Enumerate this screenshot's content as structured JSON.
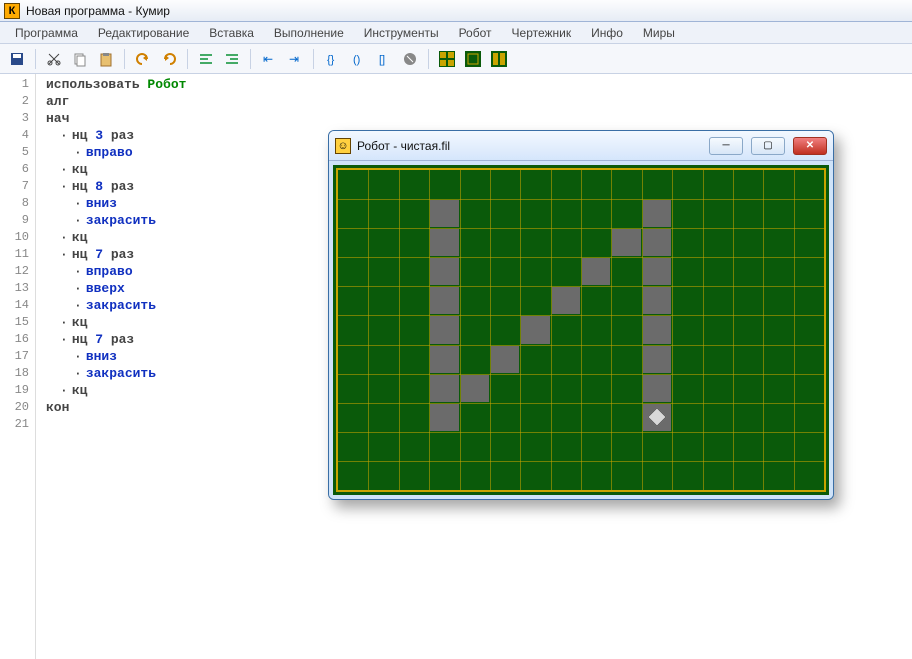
{
  "app_icon_letter": "К",
  "title": "Новая программа - Кумир",
  "menus": [
    "Программа",
    "Редактирование",
    "Вставка",
    "Выполнение",
    "Инструменты",
    "Робот",
    "Чертежник",
    "Инфо",
    "Миры"
  ],
  "toolbar_icons": [
    "save",
    "cut",
    "copy",
    "paste",
    "undo",
    "redo",
    "indent-left",
    "indent-right",
    "insert-left",
    "insert-right",
    "brace1",
    "brace2",
    "brace3",
    "stop",
    "grid-a",
    "grid-b",
    "grid-c"
  ],
  "code": [
    {
      "indent": 0,
      "tokens": [
        {
          "t": "использовать ",
          "c": "kw-gray"
        },
        {
          "t": "Робот",
          "c": "kw-use"
        }
      ]
    },
    {
      "indent": 0,
      "tokens": [
        {
          "t": "алг",
          "c": "kw-gray"
        }
      ]
    },
    {
      "indent": 0,
      "tokens": [
        {
          "t": "нач",
          "c": "kw-gray"
        }
      ]
    },
    {
      "indent": 1,
      "bullet": true,
      "tokens": [
        {
          "t": "нц ",
          "c": "kw-gray"
        },
        {
          "t": "3",
          "c": "kw-num"
        },
        {
          "t": " раз",
          "c": "kw-gray"
        }
      ]
    },
    {
      "indent": 2,
      "bullet": true,
      "tokens": [
        {
          "t": "вправо",
          "c": "kw-blue"
        }
      ]
    },
    {
      "indent": 1,
      "bullet": true,
      "tokens": [
        {
          "t": "кц",
          "c": "kw-gray"
        }
      ]
    },
    {
      "indent": 1,
      "bullet": true,
      "tokens": [
        {
          "t": "нц ",
          "c": "kw-gray"
        },
        {
          "t": "8",
          "c": "kw-num"
        },
        {
          "t": " раз",
          "c": "kw-gray"
        }
      ]
    },
    {
      "indent": 2,
      "bullet": true,
      "tokens": [
        {
          "t": "вниз",
          "c": "kw-blue"
        }
      ]
    },
    {
      "indent": 2,
      "bullet": true,
      "tokens": [
        {
          "t": "закрасить",
          "c": "kw-blue"
        }
      ]
    },
    {
      "indent": 1,
      "bullet": true,
      "tokens": [
        {
          "t": "кц",
          "c": "kw-gray"
        }
      ]
    },
    {
      "indent": 1,
      "bullet": true,
      "tokens": [
        {
          "t": "нц ",
          "c": "kw-gray"
        },
        {
          "t": "7",
          "c": "kw-num"
        },
        {
          "t": " раз",
          "c": "kw-gray"
        }
      ]
    },
    {
      "indent": 2,
      "bullet": true,
      "tokens": [
        {
          "t": "вправо",
          "c": "kw-blue"
        }
      ]
    },
    {
      "indent": 2,
      "bullet": true,
      "tokens": [
        {
          "t": "вверх",
          "c": "kw-blue"
        }
      ]
    },
    {
      "indent": 2,
      "bullet": true,
      "tokens": [
        {
          "t": "закрасить",
          "c": "kw-blue"
        }
      ]
    },
    {
      "indent": 1,
      "bullet": true,
      "tokens": [
        {
          "t": "кц",
          "c": "kw-gray"
        }
      ]
    },
    {
      "indent": 1,
      "bullet": true,
      "tokens": [
        {
          "t": "нц ",
          "c": "kw-gray"
        },
        {
          "t": "7",
          "c": "kw-num"
        },
        {
          "t": " раз",
          "c": "kw-gray"
        }
      ]
    },
    {
      "indent": 2,
      "bullet": true,
      "tokens": [
        {
          "t": "вниз",
          "c": "kw-blue"
        }
      ]
    },
    {
      "indent": 2,
      "bullet": true,
      "tokens": [
        {
          "t": "закрасить",
          "c": "kw-blue"
        }
      ]
    },
    {
      "indent": 1,
      "bullet": true,
      "tokens": [
        {
          "t": "кц",
          "c": "kw-gray"
        }
      ]
    },
    {
      "indent": 0,
      "tokens": [
        {
          "t": "кон",
          "c": "kw-gray"
        }
      ]
    },
    {
      "indent": 0,
      "tokens": []
    }
  ],
  "robot_window": {
    "title": "Робот - чистая.fil",
    "cols": 16,
    "rows": 11,
    "cell": 30,
    "filled": [
      [
        3,
        1
      ],
      [
        3,
        2
      ],
      [
        3,
        3
      ],
      [
        3,
        4
      ],
      [
        3,
        5
      ],
      [
        3,
        6
      ],
      [
        3,
        7
      ],
      [
        3,
        8
      ],
      [
        4,
        7
      ],
      [
        5,
        6
      ],
      [
        6,
        5
      ],
      [
        7,
        4
      ],
      [
        8,
        3
      ],
      [
        9,
        2
      ],
      [
        10,
        1
      ],
      [
        10,
        2
      ],
      [
        10,
        3
      ],
      [
        10,
        4
      ],
      [
        10,
        5
      ],
      [
        10,
        6
      ],
      [
        10,
        7
      ],
      [
        10,
        8
      ]
    ],
    "robot_at": [
      10,
      8
    ]
  }
}
